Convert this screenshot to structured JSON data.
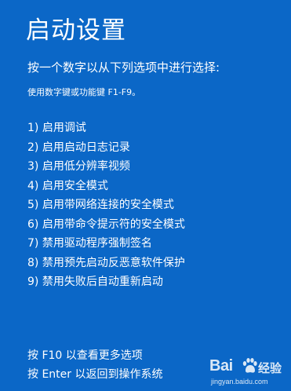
{
  "screen": {
    "title": "启动设置",
    "prompt": "按一个数字以从下列选项中进行选择:",
    "hint": "使用数字键或功能键 F1-F9。"
  },
  "options": [
    "1) 启用调试",
    "2) 启用启动日志记录",
    "3) 启用低分辨率视频",
    "4) 启用安全模式",
    "5) 启用带网络连接的安全模式",
    "6) 启用带命令提示符的安全模式",
    "7) 禁用驱动程序强制签名",
    "8) 禁用预先启动反恶意软件保护",
    "9) 禁用失败后自动重新启动"
  ],
  "footer": {
    "more_options": "按 F10 以查看更多选项",
    "return_os": "按 Enter 以返回到操作系统"
  },
  "watermark": {
    "logo_text": "Bai",
    "logo_icon": "baidu-paw-icon",
    "brand_cn": "经验",
    "url": "jingyan.baidu.com"
  },
  "colors": {
    "background": "#0b67c7",
    "text": "#ffffff"
  }
}
